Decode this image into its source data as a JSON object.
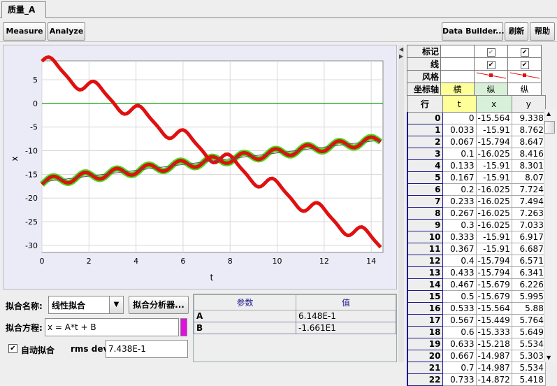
{
  "tab": {
    "title": "质量_A"
  },
  "toolbar": {
    "measure": "Measure",
    "analyze": "Analyze",
    "data_builder": "Data Builder...",
    "refresh": "刷新",
    "help": "帮助"
  },
  "plot": {
    "xlabel": "t",
    "ylabel": "x",
    "xticks": [
      "0",
      "2",
      "4",
      "6",
      "8",
      "10",
      "12",
      "14"
    ],
    "yticks": [
      "5",
      "0",
      "-5",
      "-10",
      "-15",
      "-20",
      "-25",
      "-30"
    ]
  },
  "fit": {
    "name_label": "拟合名称:",
    "name_value": "线性拟合",
    "analyzer_button": "拟合分析器...",
    "equation_label": "拟合方程:",
    "equation_value": "x = A*t + B",
    "auto_fit_label": "自动拟合",
    "rms_label": "rms dev:",
    "rms_value": "7.438E-1",
    "curve_color": "#e010e0"
  },
  "params": {
    "header_name": "参数",
    "header_value": "值",
    "rows": [
      {
        "name": "A",
        "value": "6.148E-1"
      },
      {
        "name": "B",
        "value": "-1.661E1"
      }
    ]
  },
  "columns_config": {
    "row_labels": [
      "标记",
      "线",
      "风格",
      "坐标轴"
    ],
    "axis_x": "横",
    "axis_y1": "纵",
    "axis_y2": "纵"
  },
  "data_table": {
    "row_header": "行",
    "headers": [
      "t",
      "x",
      "y"
    ],
    "rows": [
      [
        "0",
        "0",
        "-15.564",
        "9.338"
      ],
      [
        "1",
        "0.033",
        "-15.91",
        "8.762"
      ],
      [
        "2",
        "0.067",
        "-15.794",
        "8.647"
      ],
      [
        "3",
        "0.1",
        "-16.025",
        "8.416"
      ],
      [
        "4",
        "0.133",
        "-15.91",
        "8.301"
      ],
      [
        "5",
        "0.167",
        "-15.91",
        "8.07"
      ],
      [
        "6",
        "0.2",
        "-16.025",
        "7.724"
      ],
      [
        "7",
        "0.233",
        "-16.025",
        "7.494"
      ],
      [
        "8",
        "0.267",
        "-16.025",
        "7.263"
      ],
      [
        "9",
        "0.3",
        "-16.025",
        "7.033"
      ],
      [
        "10",
        "0.333",
        "-15.91",
        "6.917"
      ],
      [
        "11",
        "0.367",
        "-15.91",
        "6.687"
      ],
      [
        "12",
        "0.4",
        "-15.794",
        "6.571"
      ],
      [
        "13",
        "0.433",
        "-15.794",
        "6.341"
      ],
      [
        "14",
        "0.467",
        "-15.679",
        "6.226"
      ],
      [
        "15",
        "0.5",
        "-15.679",
        "5.995"
      ],
      [
        "16",
        "0.533",
        "-15.564",
        "5.88"
      ],
      [
        "17",
        "0.567",
        "-15.449",
        "5.764"
      ],
      [
        "18",
        "0.6",
        "-15.333",
        "5.649"
      ],
      [
        "19",
        "0.633",
        "-15.218",
        "5.534"
      ],
      [
        "20",
        "0.667",
        "-14.987",
        "5.303"
      ],
      [
        "21",
        "0.7",
        "-14.987",
        "5.534"
      ],
      [
        "22",
        "0.733",
        "-14.872",
        "5.418"
      ]
    ]
  },
  "colors": {
    "series_marker": "#e01010",
    "series_highlight": "#40e020",
    "zero_line": "#10a010",
    "plot_bg": "#ffffff"
  }
}
